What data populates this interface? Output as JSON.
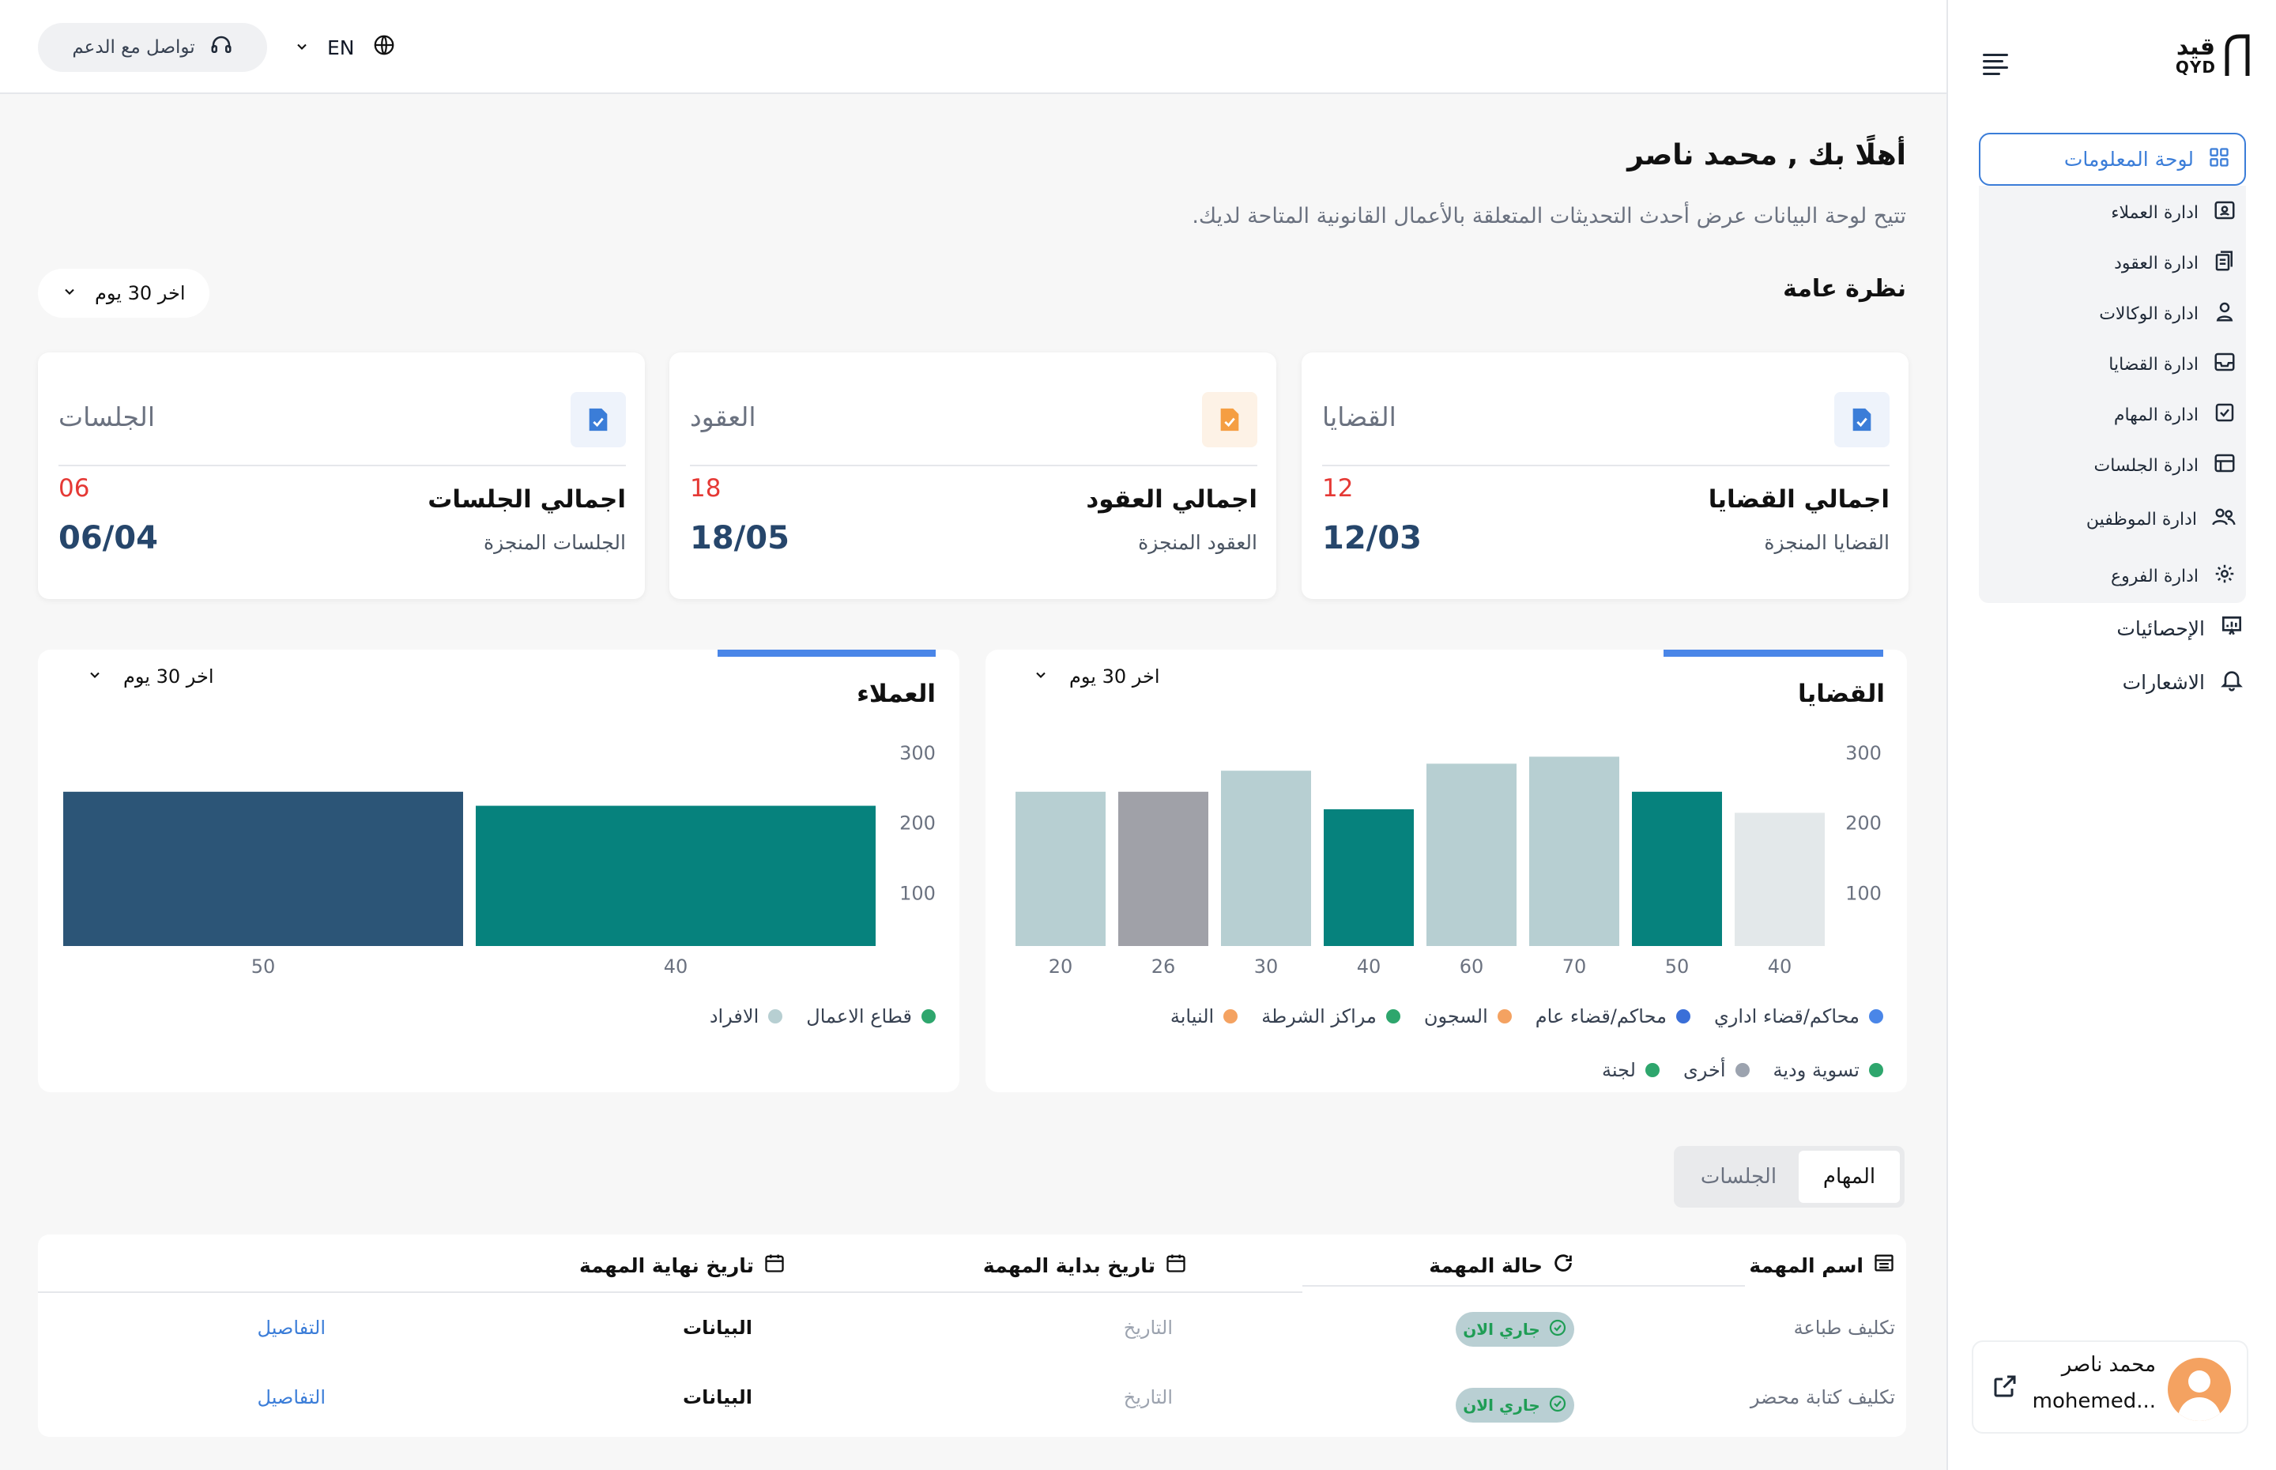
{
  "header": {
    "support_label": "تواصل مع الدعم",
    "language": "EN"
  },
  "sidebar": {
    "logo_ar": "قيد",
    "logo_en": "QYD",
    "active_item": "لوحة المعلومات",
    "items": [
      {
        "label": "ادارة العملاء",
        "icon": "contact-card-icon"
      },
      {
        "label": "ادارة العقود",
        "icon": "documents-icon"
      },
      {
        "label": "ادارة الوكالات",
        "icon": "person-icon"
      },
      {
        "label": "ادارة القضايا",
        "icon": "inbox-icon"
      },
      {
        "label": "ادارة المهام",
        "icon": "checkbox-icon"
      },
      {
        "label": "ادارة الجلسات",
        "icon": "calendar-box-icon"
      },
      {
        "label": "ادارة الموظفين",
        "icon": "users-icon"
      },
      {
        "label": "ادارة الفروع",
        "icon": "branches-icon"
      }
    ],
    "statistics": "الإحصائيات",
    "notifications": "الاشعارات",
    "profile": {
      "name": "محمد ناصر",
      "email": "mohemed..."
    }
  },
  "main": {
    "greeting": "أهلًا بك , محمد ناصر",
    "subtitle": "تتيح لوحة البيانات عرض أحدث التحديثات المتعلقة بالأعمال القانونية المتاحة لديك.",
    "overview_title": "نظرة عامة",
    "range_label": "اخر 30 يوم",
    "cards": [
      {
        "title": "القضايا",
        "total_label": "اجمالي القضايا",
        "total": "12",
        "done_label": "القضايا المنجزة",
        "done": "12/03",
        "icon_color": "#3b7dd8",
        "icon_bg": "#eef3fb"
      },
      {
        "title": "العقود",
        "total_label": "اجمالي العقود",
        "total": "18",
        "done_label": "العقود المنجزة",
        "done": "18/05",
        "icon_color": "#f59e42",
        "icon_bg": "#fdf2e6"
      },
      {
        "title": "الجلسات",
        "total_label": "اجمالي الجلسات",
        "total": "06",
        "done_label": "الجلسات المنجزة",
        "done": "06/04",
        "icon_color": "#3b7dd8",
        "icon_bg": "#eef3fb"
      }
    ],
    "cases_chart": {
      "title": "القضايا",
      "range_label": "اخر 30 يوم",
      "legend": [
        {
          "label": "محاكم/قضاء اداري",
          "color": "#4a86e8"
        },
        {
          "label": "محاكم/قضاء عام",
          "color": "#3a6fd8"
        },
        {
          "label": "السجون",
          "color": "#f4a261"
        },
        {
          "label": "مراكز الشرطة",
          "color": "#2ea66d"
        },
        {
          "label": "النيابة",
          "color": "#f4a261"
        },
        {
          "label": "تسوية ودية",
          "color": "#2ea66d"
        },
        {
          "label": "أخرى",
          "color": "#9ca3af"
        },
        {
          "label": "لجنة",
          "color": "#2ea66d"
        }
      ]
    },
    "clients_chart": {
      "title": "العملاء",
      "range_label": "اخر 30 يوم",
      "legend": [
        {
          "label": "قطاع الاعمال",
          "color": "#2ea66d"
        },
        {
          "label": "الافراد",
          "color": "#b7cfd2"
        }
      ]
    },
    "tabs": [
      {
        "label": "المهام",
        "active": true
      },
      {
        "label": "الجلسات",
        "active": false
      }
    ],
    "table": {
      "headers": {
        "name": "اسم المهمة",
        "status": "حالة المهمة",
        "start": "تاريخ بداية المهمة",
        "end": "تاريخ نهاية المهمة"
      },
      "rows": [
        {
          "name": "تكليف طباعة",
          "status": "جاري الان",
          "start": "التاريخ",
          "end": "البيانات",
          "details": "التفاصيل"
        },
        {
          "name": "تكليف كتابة محضر",
          "status": "جاري الان",
          "start": "التاريخ",
          "end": "البيانات",
          "details": "التفاصيل"
        }
      ]
    }
  },
  "chart_data": [
    {
      "type": "bar",
      "title": "القضايا",
      "categories": [
        "40",
        "50",
        "70",
        "60",
        "40",
        "30",
        "26",
        "20"
      ],
      "values": [
        215,
        245,
        295,
        285,
        220,
        275,
        245,
        245
      ],
      "colors": [
        "#e3e8ea",
        "#06827d",
        "#b7cfd2",
        "#b7cfd2",
        "#06827d",
        "#b7cfd2",
        "#a0a1a8",
        "#b7cfd2"
      ],
      "yticks": [
        100,
        200,
        300
      ],
      "ylim": [
        25,
        300
      ]
    },
    {
      "type": "bar",
      "title": "العملاء",
      "categories": [
        "40",
        "50"
      ],
      "values": [
        225,
        245
      ],
      "colors": [
        "#06827d",
        "#2c5577"
      ],
      "yticks": [
        100,
        200,
        300
      ],
      "ylim": [
        25,
        300
      ]
    }
  ]
}
